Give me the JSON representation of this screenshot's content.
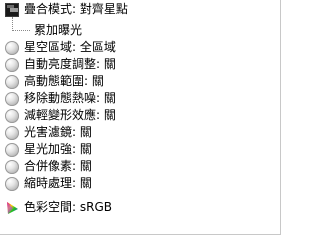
{
  "settings": {
    "overlay_mode": "疊合模式: 對齊星點",
    "overlay_child": "累加曝光",
    "items": [
      {
        "label": "星空區域: 全區域",
        "icon": "radio-bullet-icon"
      },
      {
        "label": "自動亮度調整: 關",
        "icon": "radio-bullet-icon"
      },
      {
        "label": "高動態範圍: 關",
        "icon": "radio-bullet-icon"
      },
      {
        "label": "移除動態熱噪: 關",
        "icon": "radio-bullet-icon"
      },
      {
        "label": "減輕變形效應: 關",
        "icon": "radio-bullet-icon"
      },
      {
        "label": "光害濾鏡: 關",
        "icon": "radio-bullet-icon"
      },
      {
        "label": "星光加強: 關",
        "icon": "radio-bullet-icon"
      },
      {
        "label": "合併像素: 關",
        "icon": "radio-bullet-icon"
      },
      {
        "label": "縮時處理: 關",
        "icon": "radio-bullet-icon"
      }
    ],
    "color_space": "色彩空間: sRGB"
  }
}
